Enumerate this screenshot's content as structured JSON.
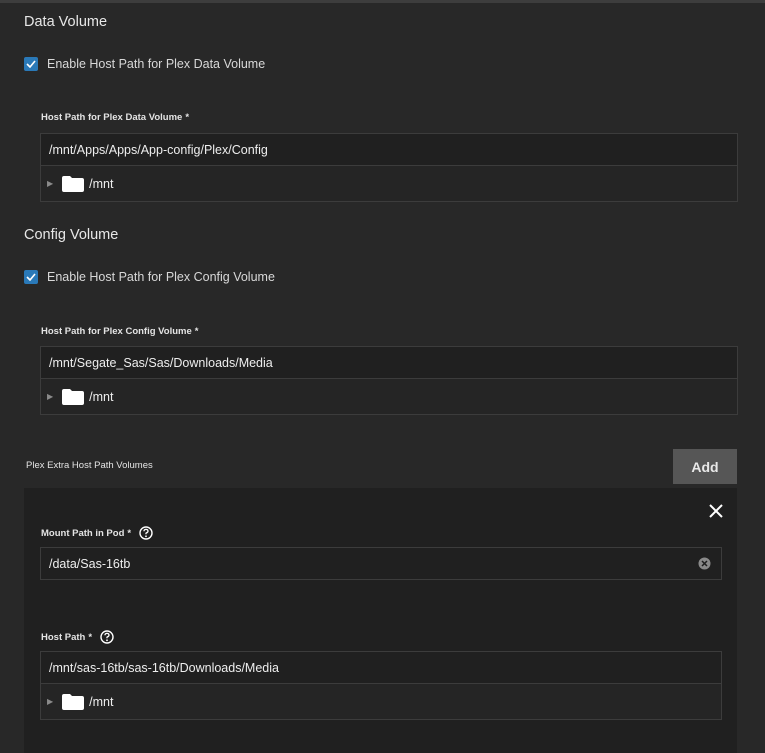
{
  "data_volume": {
    "title": "Data Volume",
    "checkbox_label": "Enable Host Path for Plex Data Volume",
    "checked": true,
    "field_label": "Host Path for Plex Data Volume",
    "required_mark": "*",
    "path_value": "/mnt/Apps/Apps/App-config/Plex/Config",
    "tree_root": "/mnt"
  },
  "config_volume": {
    "title": "Config Volume",
    "checkbox_label": "Enable Host Path for Plex Config Volume",
    "checked": true,
    "field_label": "Host Path for Plex Config Volume",
    "required_mark": "*",
    "path_value": "/mnt/Segate_Sas/Sas/Downloads/Media",
    "tree_root": "/mnt"
  },
  "extra_volumes": {
    "title": "Plex Extra Host Path Volumes",
    "add_label": "Add",
    "items": [
      {
        "mount_label": "Mount Path in Pod",
        "mount_value": "/data/Sas-16tb",
        "host_label": "Host Path",
        "host_value": "/mnt/sas-16tb/sas-16tb/Downloads/Media",
        "tree_root": "/mnt",
        "required_mark": "*"
      }
    ]
  },
  "icons": {
    "checkbox": "check-icon",
    "folder": "folder-icon",
    "expand": "expand-arrow-icon",
    "help": "help-circle-icon",
    "clear": "clear-input-icon",
    "close": "close-icon"
  },
  "colors": {
    "background": "#282828",
    "panel": "#202020",
    "checkbox_accent": "#2a79b8",
    "button": "#565656"
  }
}
